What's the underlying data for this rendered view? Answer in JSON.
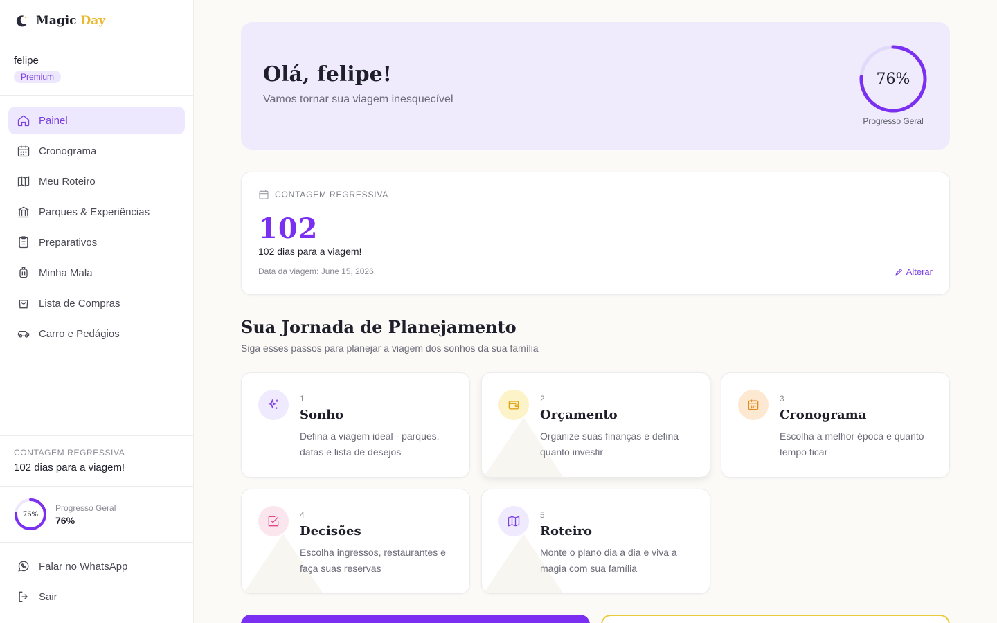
{
  "brand": {
    "name_main": "Magic",
    "name_accent": "Day"
  },
  "user": {
    "name": "felipe",
    "plan": "Premium"
  },
  "nav": {
    "items": [
      {
        "label": "Painel",
        "icon": "home-icon"
      },
      {
        "label": "Cronograma",
        "icon": "calendar-icon"
      },
      {
        "label": "Meu Roteiro",
        "icon": "map-icon"
      },
      {
        "label": "Parques & Experiências",
        "icon": "landmark-icon"
      },
      {
        "label": "Preparativos",
        "icon": "clipboard-icon"
      },
      {
        "label": "Minha Mala",
        "icon": "luggage-icon"
      },
      {
        "label": "Lista de Compras",
        "icon": "shopping-bag-icon"
      },
      {
        "label": "Carro e Pedágios",
        "icon": "car-icon"
      }
    ],
    "active": "Painel"
  },
  "sidebar": {
    "countdown_label": "CONTAGEM REGRESSIVA",
    "countdown_value": "102 dias para a viagem!",
    "progress_ring_text": "76%",
    "progress_label": "Progresso Geral",
    "progress_value": "76%",
    "progress": 0.76,
    "whatsapp": "Falar no WhatsApp",
    "logout": "Sair"
  },
  "hero": {
    "greeting": "Olá, felipe!",
    "subtitle": "Vamos tornar sua viagem inesquecível",
    "progress_text": "76%",
    "progress_label": "Progresso Geral",
    "progress": 0.76
  },
  "countdown": {
    "header": "CONTAGEM REGRESSIVA",
    "days_number": "102",
    "days_text": "102 dias para a viagem!",
    "trip_date": "Data da viagem: June 15, 2026",
    "edit_label": "Alterar"
  },
  "journey": {
    "title": "Sua Jornada de Planejamento",
    "subtitle": "Siga esses passos para planejar a viagem dos sonhos da sua família",
    "steps": [
      {
        "number": "1",
        "title": "Sonho",
        "description": "Defina a viagem ideal - parques, datas e lista de desejos",
        "icon": "sparkles-icon"
      },
      {
        "number": "2",
        "title": "Orçamento",
        "description": "Organize suas finanças e defina quanto investir",
        "icon": "wallet-icon"
      },
      {
        "number": "3",
        "title": "Cronograma",
        "description": "Escolha a melhor época e quanto tempo ficar",
        "icon": "calendar-icon"
      },
      {
        "number": "4",
        "title": "Decisões",
        "description": "Escolha ingressos, restaurantes e faça suas reservas",
        "icon": "check-square-icon"
      },
      {
        "number": "5",
        "title": "Roteiro",
        "description": "Monte o plano dia a dia e viva a magia com sua família",
        "icon": "map-icon"
      }
    ]
  },
  "colors": {
    "accent": "#7b2ff0",
    "accent_soft": "#ede8fd",
    "brand_gold": "#e9b92f",
    "background": "#fbfaf7"
  }
}
